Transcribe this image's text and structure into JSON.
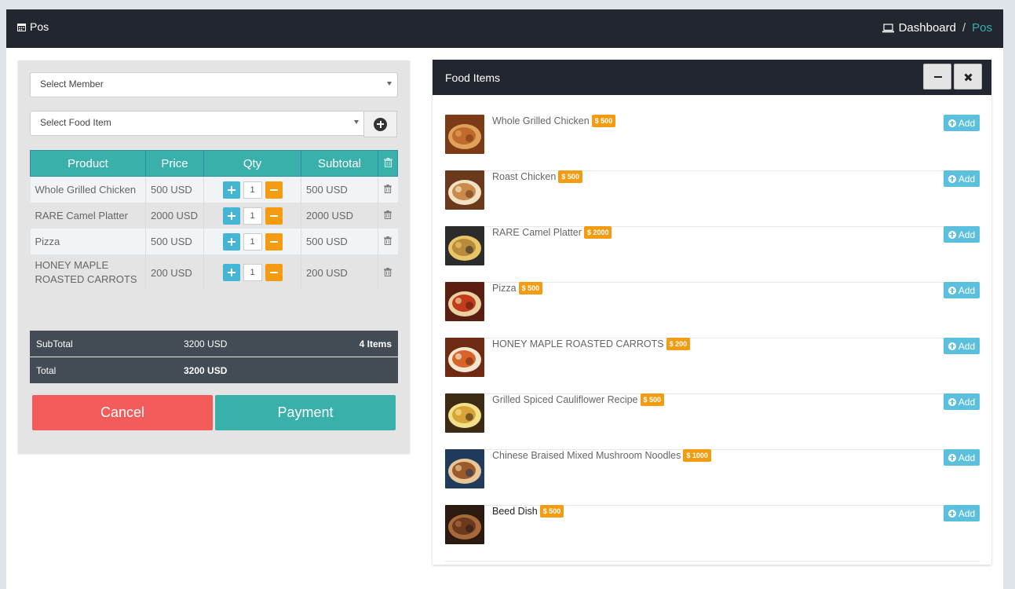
{
  "header": {
    "title": "Pos",
    "breadcrumb": {
      "home": "Dashboard",
      "separator": "/",
      "current": "Pos"
    }
  },
  "cart": {
    "member_select": "Select Member",
    "food_select": "Select Food Item",
    "columns": [
      "Product",
      "Price",
      "Qty",
      "Subtotal"
    ],
    "rows": [
      {
        "product": "Whole Grilled Chicken",
        "price": "500 USD",
        "qty": "1",
        "subtotal": "500 USD"
      },
      {
        "product": "RARE Camel Platter",
        "price": "2000 USD",
        "qty": "1",
        "subtotal": "2000 USD"
      },
      {
        "product": "Pizza",
        "price": "500 USD",
        "qty": "1",
        "subtotal": "500 USD"
      },
      {
        "product": "HONEY MAPLE ROASTED CARROTS",
        "price": "200 USD",
        "qty": "1",
        "subtotal": "200 USD"
      }
    ],
    "summary": {
      "subtotal_label": "SubTotal",
      "subtotal_value": "3200 USD",
      "items_count": "4 Items",
      "total_label": "Total",
      "total_value": "3200 USD"
    },
    "cancel_label": "Cancel",
    "payment_label": "Payment"
  },
  "food_panel": {
    "title": "Food Items",
    "add_label": "Add",
    "items": [
      {
        "name": "Whole Grilled Chicken",
        "price": "$ 500"
      },
      {
        "name": "Roast Chicken",
        "price": "$ 500"
      },
      {
        "name": "RARE Camel Platter",
        "price": "$ 2000"
      },
      {
        "name": "Pizza",
        "price": "$ 500"
      },
      {
        "name": "HONEY MAPLE ROASTED CARROTS",
        "price": "$ 200"
      },
      {
        "name": "Grilled Spiced Cauliflower Recipe",
        "price": "$ 500"
      },
      {
        "name": "Chinese Braised Mixed Mushroom Noodles",
        "price": "$ 1000"
      },
      {
        "name": "Beed Dish",
        "price": "$ 500"
      }
    ]
  },
  "colors": {
    "accent": "#3ab0aa",
    "dark": "#22262e",
    "cancel": "#f45b5b",
    "badge": "#f39c12",
    "add": "#5bc0de"
  }
}
